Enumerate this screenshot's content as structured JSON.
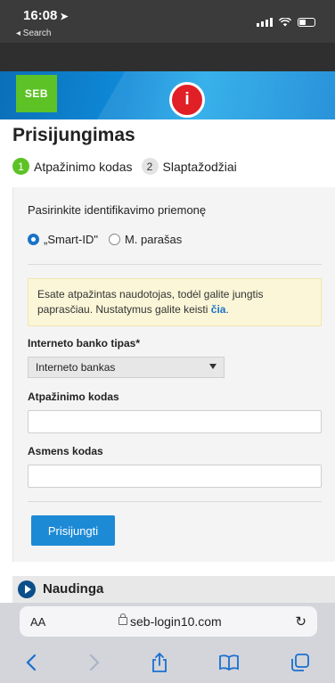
{
  "status_bar": {
    "time": "16:08",
    "back_label": "◂ Search"
  },
  "header": {
    "logo_text": "SEB",
    "info_badge": "i"
  },
  "page": {
    "title": "Prisijungimas",
    "steps": [
      {
        "number": "1",
        "label": "Atpažinimo kodas"
      },
      {
        "number": "2",
        "label": "Slaptažodžiai"
      }
    ]
  },
  "form": {
    "method_heading": "Pasirinkite identifikavimo priemonę",
    "radio_options": [
      {
        "label": "„Smart-ID\"",
        "selected": true
      },
      {
        "label": "M. parašas",
        "selected": false
      }
    ],
    "notice_text": "Esate atpažintas naudotojas, todėl galite jungtis paprasčiau. Nustatymus galite keisti ",
    "notice_link": "čia",
    "notice_end": ".",
    "bank_type_label": "Interneto banko tipas*",
    "bank_type_value": "Interneto bankas",
    "id_code_label": "Atpažinimo kodas",
    "id_code_value": "",
    "personal_code_label": "Asmens kodas",
    "personal_code_value": "",
    "submit_label": "Prisijungti"
  },
  "naudinga": {
    "label": "Naudinga"
  },
  "browser": {
    "text_size_label": "AA",
    "url": "seb-login10.com",
    "reload_icon": "↻",
    "toolbar_icons": [
      "back-icon",
      "forward-icon",
      "share-icon",
      "bookmarks-icon",
      "tabs-icon"
    ]
  },
  "colors": {
    "seb_green": "#5dc226",
    "seb_blue": "#1d8ad6",
    "alert_red": "#e11f26",
    "link_blue": "#1a73c9"
  }
}
